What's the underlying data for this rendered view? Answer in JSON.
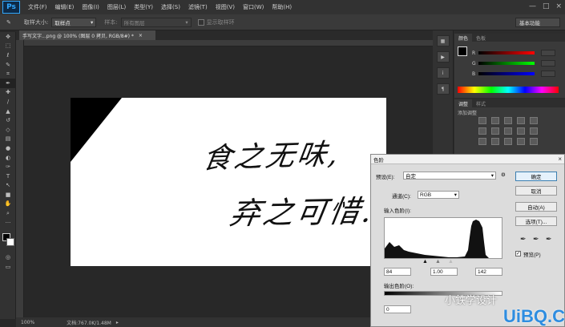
{
  "app": {
    "logo": "Ps"
  },
  "menu": [
    "文件(F)",
    "编辑(E)",
    "图像(I)",
    "图层(L)",
    "类型(Y)",
    "选择(S)",
    "滤镜(T)",
    "视图(V)",
    "窗口(W)",
    "帮助(H)"
  ],
  "window_controls": [
    "—",
    "□",
    "×"
  ],
  "options": {
    "sample_size_label": "取样大小:",
    "sample_size_value": "取样点",
    "sample_label": "样本:",
    "sample_value": "所有图层",
    "show_ring_label": "显示取样环",
    "workspace": "基本功能"
  },
  "document": {
    "tab_title": "手写文字...png @ 100% (图层 0 拷贝, RGB/8#) *",
    "zoom": "100%",
    "doc_info": "文档:767.0K/1.48M",
    "handwriting_line1": "食之无味,",
    "handwriting_line2": "弃之可惜."
  },
  "color_panel": {
    "tabs": [
      "颜色",
      "色板"
    ],
    "channels": [
      "R",
      "G",
      "B"
    ]
  },
  "adjustments_panel": {
    "tabs": [
      "调整",
      "样式"
    ],
    "add_label": "添加调整"
  },
  "levels": {
    "title": "色阶",
    "preset_label": "预设(E):",
    "preset_value": "自定",
    "channel_label": "通道(C):",
    "channel_value": "RGB",
    "input_label": "输入色阶(I):",
    "input_black": "84",
    "input_gamma": "1.00",
    "input_white": "142",
    "output_label": "输出色阶(O):",
    "output_black": "0",
    "buttons": {
      "ok": "确定",
      "cancel": "取消",
      "auto": "自动(A)",
      "options": "选项(T)..."
    },
    "preview_label": "预览(P)",
    "preview_checked": true
  },
  "watermark": {
    "text": "小鉄学设计",
    "brand": "UiBQ.CoM"
  }
}
